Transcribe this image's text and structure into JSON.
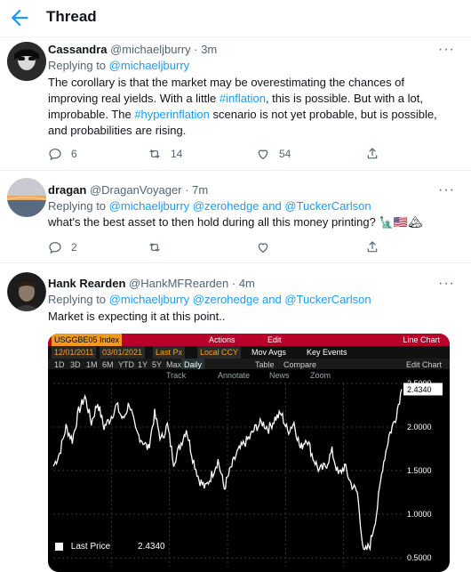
{
  "header": {
    "title": "Thread"
  },
  "colors": {
    "accent": "#1d9bf0",
    "muted": "#536471",
    "text": "#0f1419",
    "bloomberg_red": "#b8002b",
    "bloomberg_orange": "#f29a1d"
  },
  "tweets": [
    {
      "name": "Cassandra",
      "handle": "@michaeljburry",
      "time": "3m",
      "replying_prefix": "Replying to",
      "replying_to": "@michaeljburry",
      "text_1": "The corollary is that the market may be overestimating the chances of improving real yields.  With a little ",
      "hashtag_1": "#inflation",
      "text_2": ", this is possible. But with a lot, improbable.  The ",
      "hashtag_2": "#hyperinflation",
      "text_3": " scenario is not yet probable, but is possible, and probabilities are rising.",
      "replies": "6",
      "retweets": "14",
      "likes": "54"
    },
    {
      "name": "dragan",
      "handle": "@DraganVoyager",
      "time": "7m",
      "replying_prefix": "Replying to",
      "replying_to": "@michaeljburry @zerohedge and @TuckerCarlson",
      "text": "what's the best asset to then hold during all this money printing?",
      "emojis": "🗽🇺🇸🏔",
      "replies": "2"
    },
    {
      "name": "Hank Rearden",
      "handle": "@HankMFRearden",
      "time": "4m",
      "replying_prefix": "Replying to",
      "replying_to": "@michaeljburry @zerohedge and @TuckerCarlson",
      "text": "Market is expecting it at this point.."
    }
  ],
  "more_symbol": "···",
  "separator": "·",
  "bloomberg": {
    "ticker": "USGGBE05 Index",
    "actions": "Actions",
    "edit": "Edit",
    "view": "Line Chart",
    "date_from": "12/01/2011",
    "date_to": "03/01/2021",
    "field": "Last Px",
    "currency": "Local CCY",
    "mov_avgs": "Mov Avgs",
    "key_events": "Key Events",
    "periods": [
      "1D",
      "3D",
      "1M",
      "6M",
      "YTD",
      "1Y",
      "5Y",
      "Max",
      "Daily"
    ],
    "table": "Table",
    "compare": "Compare",
    "edit_chart": "Edit Chart",
    "track": "Track",
    "annotate": "Annotate",
    "news": "News",
    "zoom": "Zoom",
    "legend_label": "Last Price",
    "legend_value": "2.4340",
    "current_tag": "2.4340"
  },
  "chart_data": {
    "type": "line",
    "title": "USGGBE05 Index",
    "x_range": [
      "12/01/2011",
      "03/01/2021"
    ],
    "yticks": [
      "2.5000",
      "2.0000",
      "1.5000",
      "1.0000",
      "0.5000"
    ],
    "ylim": [
      0.4,
      2.5
    ],
    "series": [
      {
        "name": "Last Price",
        "values": [
          1.55,
          1.7,
          2.0,
          1.85,
          2.18,
          2.35,
          2.05,
          2.28,
          2.0,
          2.1,
          2.25,
          2.08,
          2.28,
          1.95,
          1.85,
          1.75,
          2.15,
          1.85,
          2.02,
          1.6,
          1.78,
          1.98,
          1.65,
          1.4,
          1.3,
          1.45,
          1.62,
          1.3,
          1.52,
          1.7,
          1.8,
          1.88,
          2.0,
          2.05,
          1.98,
          2.1,
          2.15,
          1.95,
          2.05,
          1.75,
          1.88,
          1.65,
          1.5,
          1.55,
          1.72,
          1.45,
          1.55,
          1.35,
          1.25,
          0.55,
          0.65,
          1.0,
          1.55,
          1.9,
          2.1,
          2.434
        ]
      }
    ],
    "last_value": 2.434,
    "grid": true
  }
}
